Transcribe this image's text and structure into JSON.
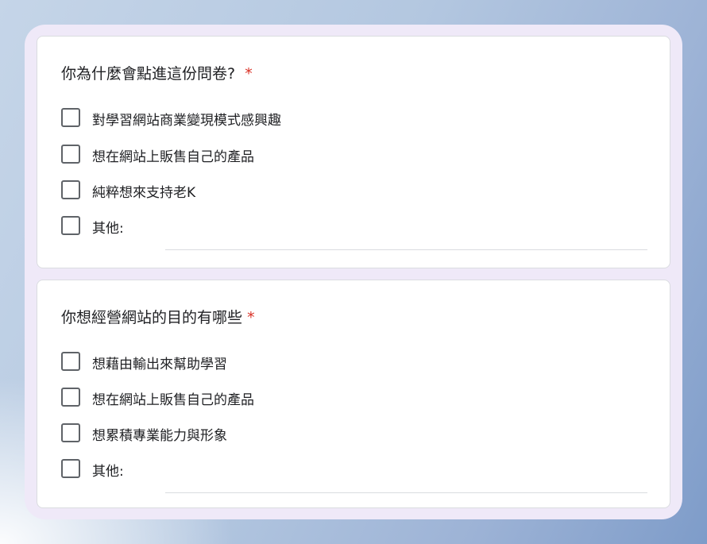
{
  "questions": [
    {
      "title": "你為什麼會點進這份問卷?",
      "required_marker": "*",
      "options": [
        "對學習網站商業變現模式感興趣",
        "想在網站上販售自己的產品",
        "純粹想來支持老K"
      ],
      "other_label": "其他:",
      "other_value": ""
    },
    {
      "title": "你想經營網站的目的有哪些",
      "required_marker": "*",
      "options": [
        "想藉由輸出來幫助學習",
        "想在網站上販售自己的產品",
        "想累積專業能力與形象"
      ],
      "other_label": "其他:",
      "other_value": ""
    }
  ],
  "colors": {
    "required": "#d93025",
    "checkbox_border": "#5f6368",
    "card_bg": "#ffffff",
    "frame_bg": "#efe9f8"
  }
}
